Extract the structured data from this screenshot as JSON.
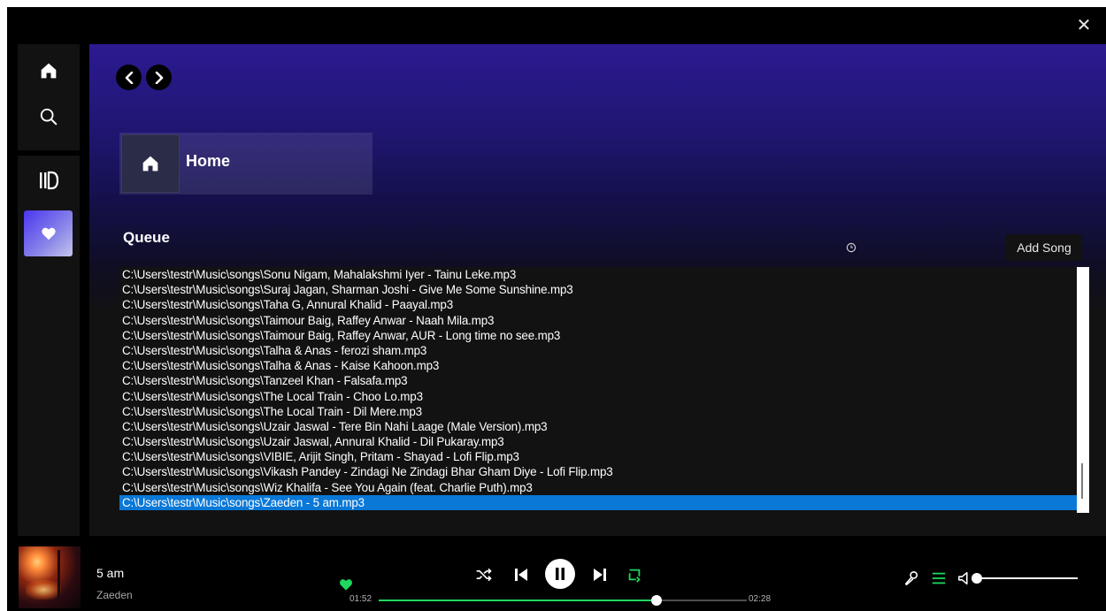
{
  "window": {
    "close_icon": "close-icon"
  },
  "sidebar": {
    "top_items": [
      {
        "name": "home",
        "icon": "home-icon"
      },
      {
        "name": "search",
        "icon": "search-icon"
      }
    ],
    "library_icon": "library-icon",
    "liked_songs_icon": "heart-icon",
    "liked_gradient": [
      "#4a36f0",
      "#c6c6ee"
    ]
  },
  "main": {
    "nav": {
      "back_icon": "chevron-left-icon",
      "forward_icon": "chevron-right-icon"
    },
    "home_card": {
      "label": "Home",
      "icon": "home-icon"
    },
    "queue": {
      "title": "Queue",
      "add_song_label": "Add Song",
      "selected_index": 15,
      "items": [
        "C:\\Users\\testr\\Music\\songs\\Sonu Nigam, Mahalakshmi Iyer - Tainu Leke.mp3",
        "C:\\Users\\testr\\Music\\songs\\Suraj Jagan, Sharman Joshi - Give Me Some Sunshine.mp3",
        "C:\\Users\\testr\\Music\\songs\\Taha G, Annural Khalid - Paayal.mp3",
        "C:\\Users\\testr\\Music\\songs\\Taimour Baig, Raffey Anwar - Naah Mila.mp3",
        "C:\\Users\\testr\\Music\\songs\\Taimour Baig, Raffey Anwar, AUR - Long time no see.mp3",
        "C:\\Users\\testr\\Music\\songs\\Talha & Anas - ferozi sham.mp3",
        "C:\\Users\\testr\\Music\\songs\\Talha & Anas - Kaise Kahoon.mp3",
        "C:\\Users\\testr\\Music\\songs\\Tanzeel Khan - Falsafa.mp3",
        "C:\\Users\\testr\\Music\\songs\\The Local Train - Choo Lo.mp3",
        "C:\\Users\\testr\\Music\\songs\\The Local Train - Dil Mere.mp3",
        "C:\\Users\\testr\\Music\\songs\\Uzair Jaswal - Tere Bin Nahi Laage (Male Version).mp3",
        "C:\\Users\\testr\\Music\\songs\\Uzair Jaswal, Annural Khalid - Dil Pukaray.mp3",
        "C:\\Users\\testr\\Music\\songs\\VIBIE, Arijit Singh, Pritam - Shayad - Lofi Flip.mp3",
        "C:\\Users\\testr\\Music\\songs\\Vikash Pandey - Zindagi Ne Zindagi Bhar Gham Diye - Lofi Flip.mp3",
        "C:\\Users\\testr\\Music\\songs\\Wiz Khalifa - See You Again (feat. Charlie Puth).mp3",
        "C:\\Users\\testr\\Music\\songs\\Zaeden - 5 am.mp3"
      ]
    }
  },
  "player": {
    "track_title": "5 am",
    "track_artist": "Zaeden",
    "liked": true,
    "time_elapsed": "01:52",
    "time_total": "02:28",
    "progress_fraction": 0.755,
    "volume_fraction": 0.0,
    "accent_color": "#1ed760",
    "selection_color": "#0a78d7",
    "controls": {
      "shuffle_icon": "shuffle-icon",
      "prev_icon": "skip-previous-icon",
      "play_pause_icon": "pause-icon",
      "next_icon": "skip-next-icon",
      "repeat_icon": "repeat-icon"
    },
    "right_controls": {
      "lyrics_icon": "microphone-icon",
      "queue_icon": "queue-icon",
      "volume_icon": "volume-icon"
    }
  }
}
